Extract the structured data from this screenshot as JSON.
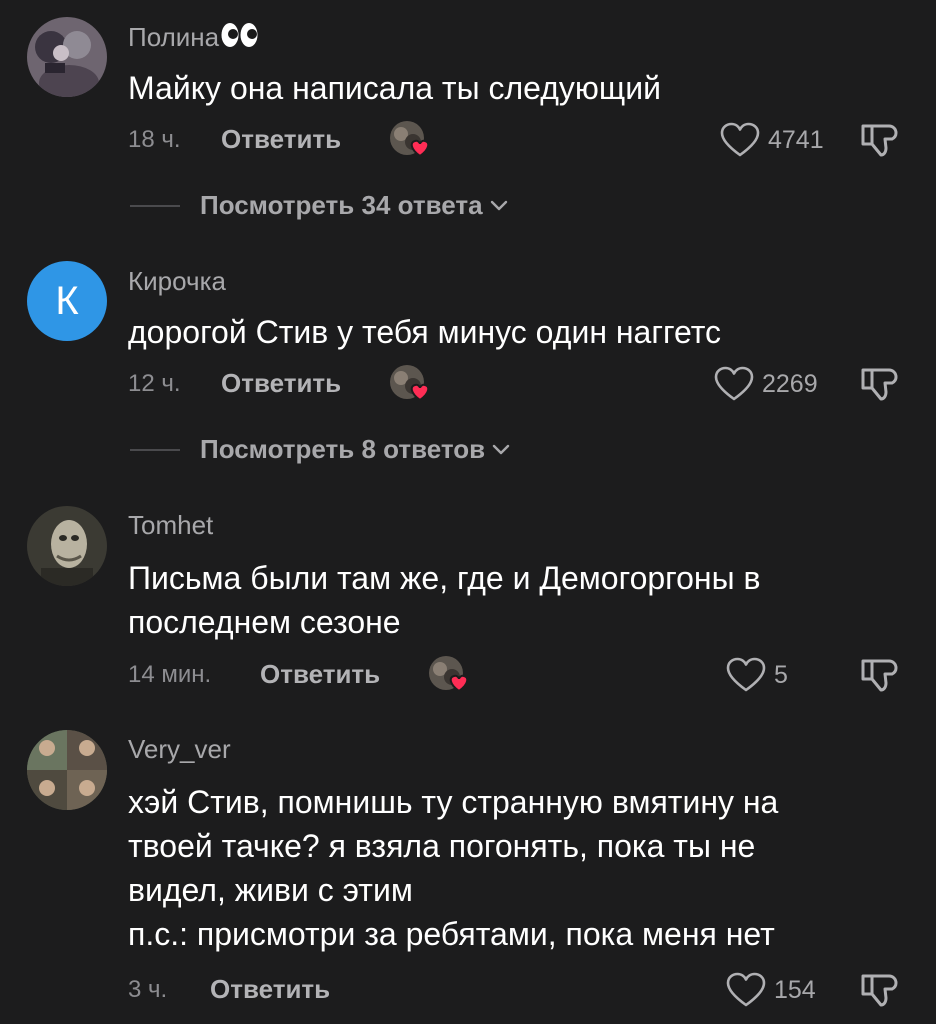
{
  "colors": {
    "background": "#1c1c1d",
    "text_primary": "#ffffff",
    "text_secondary": "#a8a8ab",
    "heart_badge": "#ff2d55",
    "letter_avatar": "#2f96e6"
  },
  "comments": [
    {
      "username": "Полина",
      "username_emoji": "eyes-emoji-icon",
      "text_lines": [
        "Майку она написала ты следующий"
      ],
      "time": "18 ч.",
      "reply_label": "Ответить",
      "creator_liked": true,
      "like_count": "4741",
      "view_replies": "Посмотреть 34 ответа"
    },
    {
      "username": "Кирочка",
      "avatar_letter": "К",
      "text_lines": [
        "дорогой Стив у тебя минус один наггетс"
      ],
      "time": "12 ч.",
      "reply_label": "Ответить",
      "creator_liked": true,
      "like_count": "2269",
      "view_replies": "Посмотреть 8 ответов"
    },
    {
      "username": "Tomhet",
      "text_lines": [
        "Письма были там же, где и Демогоргоны в",
        "последнем сезоне"
      ],
      "time": "14 мин.",
      "reply_label": "Ответить",
      "creator_liked": true,
      "like_count": "5"
    },
    {
      "username": "Very_ver",
      "text_lines": [
        "хэй Стив, помнишь ту странную вмятину на",
        "твоей тачке? я взяла погонять, пока ты не",
        "видел, живи с этим",
        "п.с.: присмотри за ребятами, пока меня нет"
      ],
      "time": "3 ч.",
      "reply_label": "Ответить",
      "like_count": "154"
    }
  ]
}
